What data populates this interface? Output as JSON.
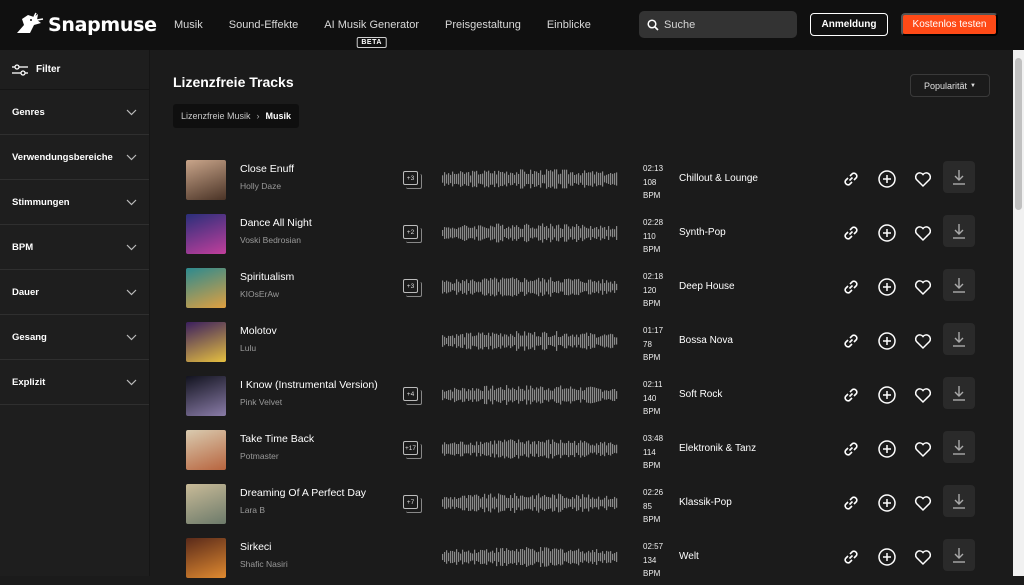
{
  "brand": {
    "name": "Snapmuse"
  },
  "nav": [
    {
      "label": "Musik"
    },
    {
      "label": "Sound-Effekte"
    },
    {
      "label": "AI Musik Generator",
      "badge": "BETA"
    },
    {
      "label": "Preisgestaltung"
    },
    {
      "label": "Einblicke"
    }
  ],
  "search": {
    "placeholder": "Suche"
  },
  "header": {
    "login_label": "Anmeldung",
    "trial_label": "Kostenlos testen",
    "trial_color": "#ff4a17"
  },
  "sidebar": {
    "filter_label": "Filter",
    "groups": [
      {
        "label": "Genres"
      },
      {
        "label": "Verwendungsbereiche"
      },
      {
        "label": "Stimmungen"
      },
      {
        "label": "BPM"
      },
      {
        "label": "Dauer"
      },
      {
        "label": "Gesang"
      },
      {
        "label": "Explizit"
      }
    ]
  },
  "main": {
    "title": "Lizenzfreie Tracks",
    "sort_label": "Popularität",
    "breadcrumb": [
      {
        "label": "Lizenzfreie Musik"
      },
      {
        "label": "Musik"
      }
    ]
  },
  "tracks": [
    {
      "title": "Close Enuff",
      "artist": "Holly Daze",
      "stems": "+3",
      "duration": "02:13",
      "bpm": "108",
      "bpm_unit": "BPM",
      "genre": "Chillout & Lounge",
      "cover_colors": [
        "#c9a58a",
        "#4a3326"
      ]
    },
    {
      "title": "Dance All Night",
      "artist": "Voski Bedrosian",
      "stems": "+2",
      "duration": "02:28",
      "bpm": "110",
      "bpm_unit": "BPM",
      "genre": "Synth-Pop",
      "cover_colors": [
        "#2a2f7a",
        "#c23f9c"
      ]
    },
    {
      "title": "Spiritualism",
      "artist": "KIOsErAw",
      "stems": "+3",
      "duration": "02:18",
      "bpm": "120",
      "bpm_unit": "BPM",
      "genre": "Deep House",
      "cover_colors": [
        "#2c8a8f",
        "#e0a040"
      ]
    },
    {
      "title": "Molotov",
      "artist": "Lulu",
      "stems": "",
      "duration": "01:17",
      "bpm": "78",
      "bpm_unit": "BPM",
      "genre": "Bossa Nova",
      "cover_colors": [
        "#3b1f5f",
        "#e6c040"
      ]
    },
    {
      "title": "I Know (Instrumental Version)",
      "artist": "Pink Velvet",
      "stems": "+4",
      "duration": "02:11",
      "bpm": "140",
      "bpm_unit": "BPM",
      "genre": "Soft Rock",
      "cover_colors": [
        "#12131f",
        "#8a7ca8"
      ]
    },
    {
      "title": "Take Time Back",
      "artist": "Potmaster",
      "stems": "+17",
      "duration": "03:48",
      "bpm": "114",
      "bpm_unit": "BPM",
      "genre": "Elektronik & Tanz",
      "cover_colors": [
        "#d9cbb0",
        "#b8643e"
      ]
    },
    {
      "title": "Dreaming Of A Perfect Day",
      "artist": "Lara B",
      "stems": "+7",
      "duration": "02:26",
      "bpm": "85",
      "bpm_unit": "BPM",
      "genre": "Klassik-Pop",
      "cover_colors": [
        "#c9bb98",
        "#6c7a6a"
      ]
    },
    {
      "title": "Sirkeci",
      "artist": "Shafic Nasiri",
      "stems": "",
      "duration": "02:57",
      "bpm": "134",
      "bpm_unit": "BPM",
      "genre": "Welt",
      "cover_colors": [
        "#5a2a1a",
        "#e08a30"
      ]
    }
  ]
}
